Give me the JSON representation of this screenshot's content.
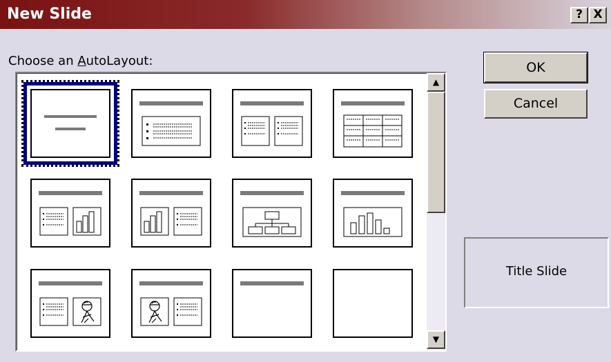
{
  "window": {
    "title": "New Slide",
    "help_label": "?",
    "close_label": "X"
  },
  "prompt": "Choose an AutoLayout:",
  "buttons": {
    "ok": "OK",
    "cancel": "Cancel"
  },
  "selected_layout_name": "Title Slide",
  "scrollbar": {
    "up_arrow": "▲",
    "down_arrow": "▼"
  },
  "layouts": [
    {
      "id": "title-slide",
      "icon": "title-slide-icon"
    },
    {
      "id": "bulleted-list",
      "icon": "bulleted-list-icon"
    },
    {
      "id": "two-column-text",
      "icon": "two-column-text-icon"
    },
    {
      "id": "table",
      "icon": "table-icon"
    },
    {
      "id": "text-and-chart",
      "icon": "text-and-chart-icon"
    },
    {
      "id": "chart-and-text",
      "icon": "chart-and-text-icon"
    },
    {
      "id": "organization-chart",
      "icon": "org-chart-icon"
    },
    {
      "id": "chart",
      "icon": "chart-icon"
    },
    {
      "id": "text-and-clip-art",
      "icon": "text-and-clip-art-icon"
    },
    {
      "id": "clip-art-and-text",
      "icon": "clip-art-and-text-icon"
    },
    {
      "id": "title-only",
      "icon": "title-only-icon"
    },
    {
      "id": "blank",
      "icon": "blank-icon"
    }
  ]
}
